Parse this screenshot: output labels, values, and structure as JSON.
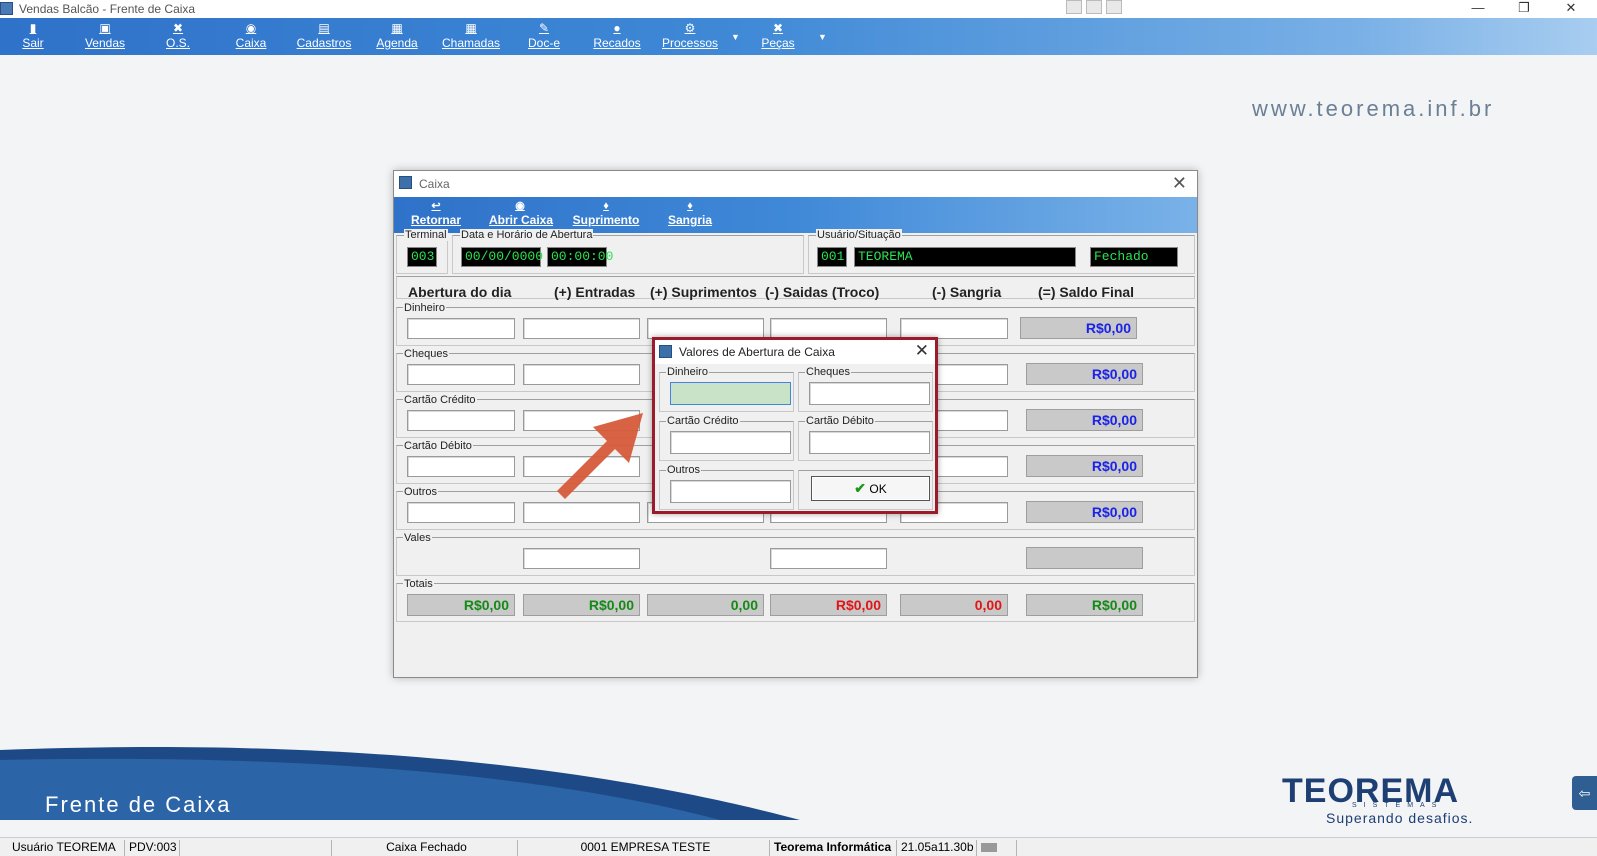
{
  "window": {
    "title": "Vendas Balcão - Frente de Caixa",
    "controls": [
      "—",
      "❐",
      "✕"
    ]
  },
  "toolbar": {
    "items": [
      {
        "label": "Sair",
        "icon": "door-icon"
      },
      {
        "label": "Vendas",
        "icon": "box-icon"
      },
      {
        "label": "O.S.",
        "icon": "tools-icon"
      },
      {
        "label": "Caixa",
        "icon": "coins-icon"
      },
      {
        "label": "Cadastros",
        "icon": "form-icon"
      },
      {
        "label": "Agenda",
        "icon": "calendar-icon"
      },
      {
        "label": "Chamadas",
        "icon": "grid-icon"
      },
      {
        "label": "Doc-e",
        "icon": "document-icon"
      },
      {
        "label": "Recados",
        "icon": "chat-icon"
      },
      {
        "label": "Processos",
        "icon": "gear-icon"
      },
      {
        "label": "Peças",
        "icon": "tools-icon"
      }
    ]
  },
  "background": {
    "watermark": "www.teorema.inf.br",
    "footer_title": "Frente de Caixa",
    "logo_name": "TEOREMA",
    "logo_sub": "SISTEMAS",
    "logo_tagline": "Superando desafios."
  },
  "caixa": {
    "title": "Caixa",
    "buttons": {
      "retornar": "Retornar",
      "abrir": "Abrir Caixa",
      "suprimento": "Suprimento",
      "sangria": "Sangria"
    },
    "terminal_label": "Terminal",
    "terminal": "003",
    "abertura_label": "Data e Horário de Abertura",
    "data": "00/00/0000",
    "hora": "00:00:00",
    "usuario_label": "Usuário/Situação",
    "usuario_cod": "001",
    "usuario_nome": "TEOREMA",
    "situacao": "Fechado",
    "headers": [
      "Abertura do dia",
      "(+) Entradas",
      "(+) Suprimentos",
      "(-) Saidas (Troco)",
      "(-) Sangria",
      "(=) Saldo Final"
    ],
    "rows": [
      {
        "label": "Dinheiro",
        "saldo": "R$0,00"
      },
      {
        "label": "Cheques",
        "saldo": "R$0,00"
      },
      {
        "label": "Cartão Crédito",
        "saldo": "R$0,00"
      },
      {
        "label": "Cartão Débito",
        "saldo": "R$0,00"
      },
      {
        "label": "Outros",
        "saldo": "R$0,00"
      },
      {
        "label": "Vales",
        "saldo": ""
      }
    ],
    "totais_label": "Totais",
    "totais": [
      "R$0,00",
      "R$0,00",
      "0,00",
      "R$0,00",
      "0,00",
      "R$0,00"
    ]
  },
  "dialog": {
    "title": "Valores de Abertura de Caixa",
    "dinheiro": "Dinheiro",
    "cheques": "Cheques",
    "credito": "Cartão Crédito",
    "debito": "Cartão Débito",
    "outros": "Outros",
    "ok": "OK"
  },
  "statusbar": [
    "Usuário TEOREMA",
    "PDV:003",
    "",
    "Caixa Fechado",
    "0001 EMPRESA TESTE",
    "Teorema Informática",
    "21.05a11.30b",
    ""
  ],
  "colors": {
    "toolbar": "#2f72c9",
    "lcd_text": "#2be34f",
    "saldo": "#1b23e6",
    "total_green": "#168a16",
    "total_red": "#e01515",
    "dialog_border": "#9b1b2a",
    "arrow": "#d65a3a"
  }
}
